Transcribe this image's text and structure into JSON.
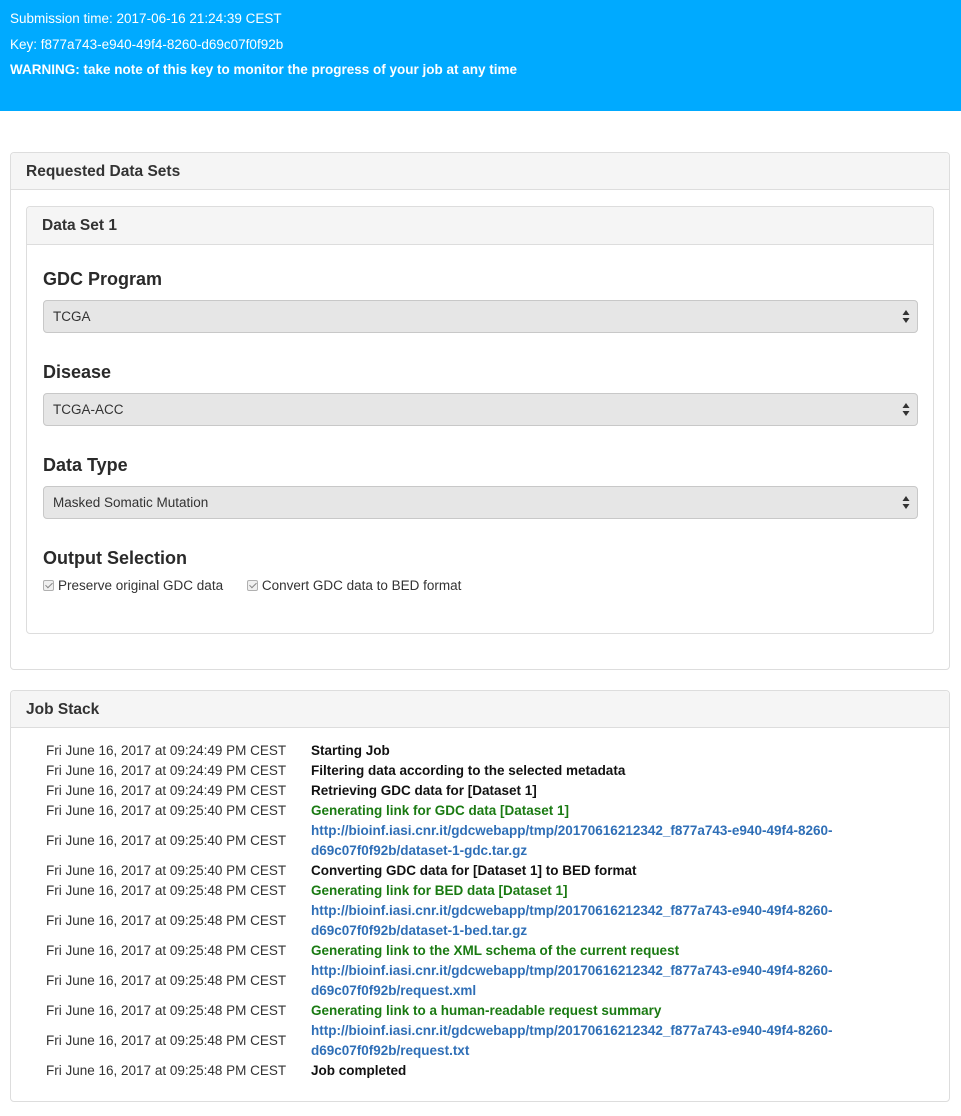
{
  "banner": {
    "submission_time": "Submission time: 2017-06-16 21:24:39 CEST",
    "key": "Key: f877a743-e940-49f4-8260-d69c07f0f92b",
    "warning": "WARNING: take note of this key to monitor the progress of your job at any time"
  },
  "requested": {
    "title": "Requested Data Sets",
    "dataset": {
      "title": "Data Set 1",
      "program_label": "GDC Program",
      "program_value": "TCGA",
      "disease_label": "Disease",
      "disease_value": "TCGA-ACC",
      "datatype_label": "Data Type",
      "datatype_value": "Masked Somatic Mutation",
      "output_label": "Output Selection",
      "options": [
        {
          "label": "Preserve original GDC data",
          "checked": true
        },
        {
          "label": "Convert GDC data to BED format",
          "checked": true
        }
      ]
    }
  },
  "job_stack": {
    "title": "Job Stack",
    "rows": [
      {
        "time": "Fri June 16, 2017 at 09:24:49 PM CEST",
        "message": "Starting Job",
        "kind": "black"
      },
      {
        "time": "Fri June 16, 2017 at 09:24:49 PM CEST",
        "message": "Filtering data according to the selected metadata",
        "kind": "black"
      },
      {
        "time": "Fri June 16, 2017 at 09:24:49 PM CEST",
        "message": "Retrieving GDC data for [Dataset 1]",
        "kind": "black"
      },
      {
        "time": "Fri June 16, 2017 at 09:25:40 PM CEST",
        "message": "Generating link for GDC data [Dataset 1]",
        "kind": "green"
      },
      {
        "time": "Fri June 16, 2017 at 09:25:40 PM CEST",
        "message": "http://bioinf.iasi.cnr.it/gdcwebapp/tmp/20170616212342_f877a743-e940-49f4-8260-d69c07f0f92b/dataset-1-gdc.tar.gz",
        "kind": "link"
      },
      {
        "time": "Fri June 16, 2017 at 09:25:40 PM CEST",
        "message": "Converting GDC data for [Dataset 1] to BED format",
        "kind": "black"
      },
      {
        "time": "Fri June 16, 2017 at 09:25:48 PM CEST",
        "message": "Generating link for BED data [Dataset 1]",
        "kind": "green"
      },
      {
        "time": "Fri June 16, 2017 at 09:25:48 PM CEST",
        "message": "http://bioinf.iasi.cnr.it/gdcwebapp/tmp/20170616212342_f877a743-e940-49f4-8260-d69c07f0f92b/dataset-1-bed.tar.gz",
        "kind": "link"
      },
      {
        "time": "Fri June 16, 2017 at 09:25:48 PM CEST",
        "message": "Generating link to the XML schema of the current request",
        "kind": "green"
      },
      {
        "time": "Fri June 16, 2017 at 09:25:48 PM CEST",
        "message": "http://bioinf.iasi.cnr.it/gdcwebapp/tmp/20170616212342_f877a743-e940-49f4-8260-d69c07f0f92b/request.xml",
        "kind": "link"
      },
      {
        "time": "Fri June 16, 2017 at 09:25:48 PM CEST",
        "message": "Generating link to a human-readable request summary",
        "kind": "green"
      },
      {
        "time": "Fri June 16, 2017 at 09:25:48 PM CEST",
        "message": "http://bioinf.iasi.cnr.it/gdcwebapp/tmp/20170616212342_f877a743-e940-49f4-8260-d69c07f0f92b/request.txt",
        "kind": "link"
      },
      {
        "time": "Fri June 16, 2017 at 09:25:48 PM CEST",
        "message": "Job completed",
        "kind": "black"
      }
    ]
  }
}
